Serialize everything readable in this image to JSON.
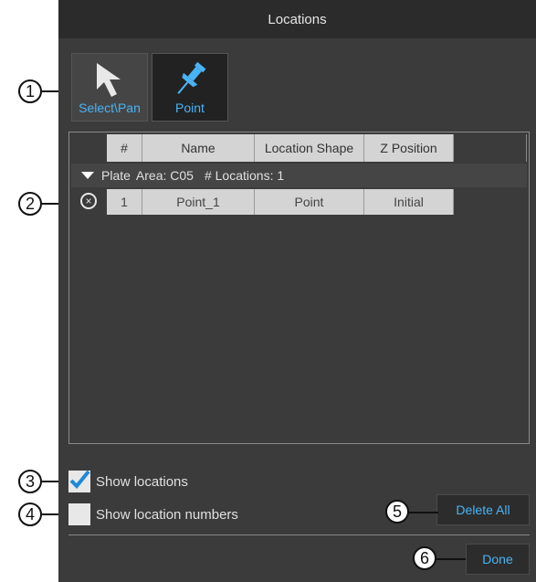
{
  "window": {
    "title": "Locations"
  },
  "tools": [
    {
      "label": "Select\\Pan",
      "icon": "arrow-cursor-icon"
    },
    {
      "label": "Point",
      "icon": "pushpin-icon"
    }
  ],
  "grid": {
    "columns": [
      "#",
      "Name",
      "Location Shape",
      "Z Position"
    ],
    "group": {
      "plate_label": "Plate",
      "area_text": "Area: C05",
      "count_text": "# Locations: 1"
    },
    "rows": [
      {
        "num": "1",
        "name": "Point_1",
        "shape": "Point",
        "z": "Initial"
      }
    ]
  },
  "options": {
    "show_locations": {
      "label": "Show locations",
      "checked": true
    },
    "show_numbers": {
      "label": "Show location numbers",
      "checked": false
    }
  },
  "buttons": {
    "delete_all": "Delete All",
    "done": "Done"
  },
  "callouts": [
    "1",
    "2",
    "3",
    "4",
    "5",
    "6"
  ],
  "colors": {
    "accent": "#4ab3f4",
    "panel": "#3b3b3b",
    "titlebar": "#2b2b2b"
  }
}
